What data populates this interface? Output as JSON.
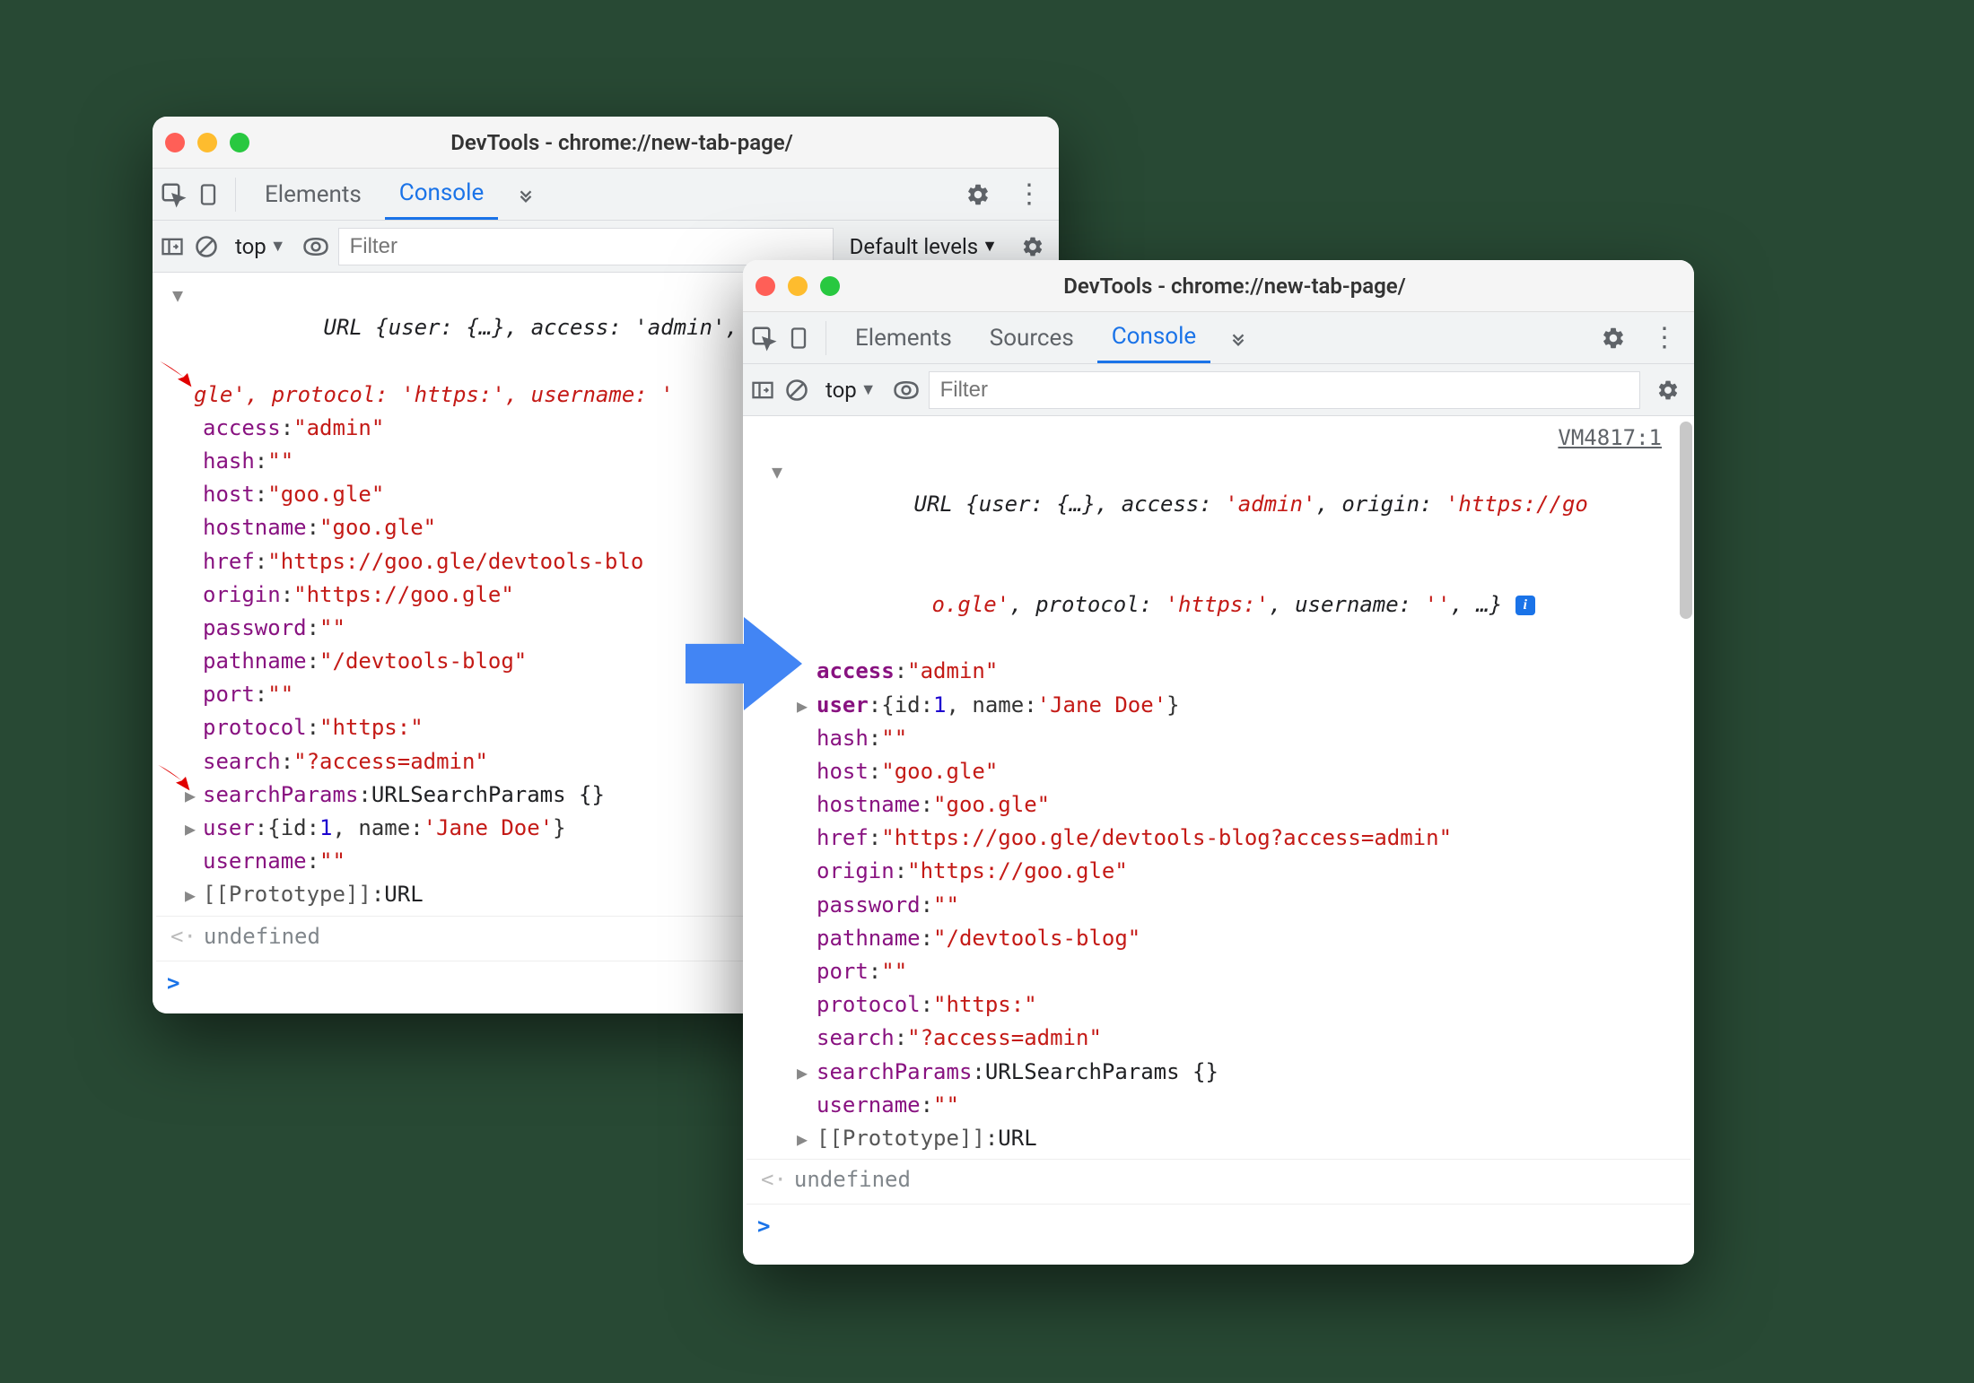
{
  "leftWindow": {
    "title": "DevTools - chrome://new-tab-page/",
    "tabs": {
      "elements": "Elements",
      "console": "Console"
    },
    "filter": {
      "scope": "top",
      "placeholder": "Filter",
      "levels": "Default levels"
    },
    "summary1": "URL {user: {…}, access: 'admin', orig",
    "summary2": "gle', protocol: 'https:', username: '",
    "props": {
      "access": {
        "k": "access",
        "v": "\"admin\""
      },
      "hash": {
        "k": "hash",
        "v": "\"\""
      },
      "host": {
        "k": "host",
        "v": "\"goo.gle\""
      },
      "hostname": {
        "k": "hostname",
        "v": "\"goo.gle\""
      },
      "href": {
        "k": "href",
        "v": "\"https://goo.gle/devtools-blo"
      },
      "origin": {
        "k": "origin",
        "v": "\"https://goo.gle\""
      },
      "password": {
        "k": "password",
        "v": "\"\""
      },
      "pathname": {
        "k": "pathname",
        "v": "\"/devtools-blog\""
      },
      "port": {
        "k": "port",
        "v": "\"\""
      },
      "protocol": {
        "k": "protocol",
        "v": "\"https:\""
      },
      "search": {
        "k": "search",
        "v": "\"?access=admin\""
      },
      "searchParams": {
        "k": "searchParams",
        "v": "URLSearchParams {}"
      },
      "user_k": "user",
      "user_pre": "{id: ",
      "user_id": "1",
      "user_mid": ", name: ",
      "user_name": "'Jane Doe'",
      "user_post": "}",
      "username": {
        "k": "username",
        "v": "\"\""
      },
      "proto": {
        "k": "[[Prototype]]",
        "v": "URL"
      }
    },
    "undefined": "undefined"
  },
  "rightWindow": {
    "title": "DevTools - chrome://new-tab-page/",
    "tabs": {
      "elements": "Elements",
      "sources": "Sources",
      "console": "Console"
    },
    "filter": {
      "scope": "top",
      "placeholder": "Filter"
    },
    "sourceLink": "VM4817:1",
    "summary1a": "URL {user: {…}, access: ",
    "summary1b": "'admin'",
    "summary1c": ", origin: ",
    "summary1d": "'https://go",
    "summary2a": "o.gle'",
    "summary2b": ", protocol: ",
    "summary2c": "'https:'",
    "summary2d": ", username: ",
    "summary2e": "''",
    "summary2f": ", …} ",
    "props": {
      "access": {
        "k": "access",
        "v": "\"admin\""
      },
      "user_k": "user",
      "user_pre": "{id: ",
      "user_id": "1",
      "user_mid": ", name: ",
      "user_name": "'Jane Doe'",
      "user_post": "}",
      "hash": {
        "k": "hash",
        "v": "\"\""
      },
      "host": {
        "k": "host",
        "v": "\"goo.gle\""
      },
      "hostname": {
        "k": "hostname",
        "v": "\"goo.gle\""
      },
      "href": {
        "k": "href",
        "v": "\"https://goo.gle/devtools-blog?access=admin\""
      },
      "origin": {
        "k": "origin",
        "v": "\"https://goo.gle\""
      },
      "password": {
        "k": "password",
        "v": "\"\""
      },
      "pathname": {
        "k": "pathname",
        "v": "\"/devtools-blog\""
      },
      "port": {
        "k": "port",
        "v": "\"\""
      },
      "protocol": {
        "k": "protocol",
        "v": "\"https:\""
      },
      "search": {
        "k": "search",
        "v": "\"?access=admin\""
      },
      "searchParams": {
        "k": "searchParams",
        "v": "URLSearchParams {}"
      },
      "username": {
        "k": "username",
        "v": "\"\""
      },
      "proto": {
        "k": "[[Prototype]]",
        "v": "URL"
      }
    },
    "undefined": "undefined"
  }
}
